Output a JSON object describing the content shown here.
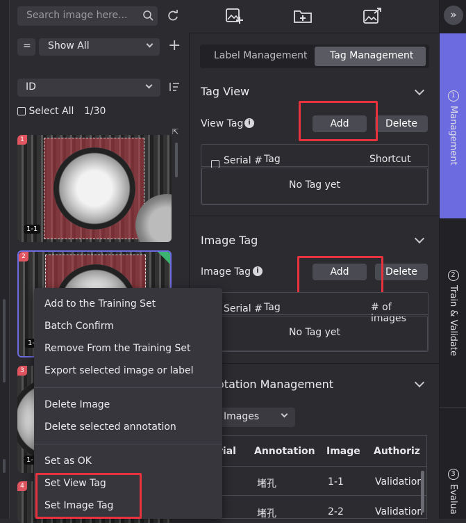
{
  "left": {
    "search_placeholder": "Search image here...",
    "filter_operator": "=",
    "filter_value": "Show All",
    "sort_field": "ID",
    "select_all_label": "Select All",
    "selection_count": "1/30",
    "thumbnails": [
      {
        "index": "1",
        "label": "1-1"
      },
      {
        "index": "2",
        "label": "1-"
      },
      {
        "index": "3",
        "label": "1-"
      },
      {
        "index": "4",
        "label": ""
      }
    ]
  },
  "context_menu": {
    "items": [
      "Add to the Training Set",
      "Batch Confirm",
      "Remove From the Training Set",
      "Export selected image or label",
      "Delete Image",
      "Delete selected annotation",
      "Set as OK",
      "Set View Tag",
      "Set Image Tag"
    ]
  },
  "toolbar": {
    "icons": [
      "add-image-icon",
      "add-folder-icon",
      "export-image-icon"
    ]
  },
  "management": {
    "tabs": [
      "Label Management",
      "Tag Management"
    ],
    "active_tab": "Tag Management",
    "tag_view": {
      "title": "Tag View",
      "row_label": "View Tag",
      "add_label": "Add",
      "delete_label": "Delete",
      "columns": [
        "Serial #",
        "Tag",
        "Shortcut"
      ],
      "empty_text": "No Tag yet"
    },
    "image_tag": {
      "title": "Image Tag",
      "row_label": "Image Tag",
      "add_label": "Add",
      "delete_label": "Delete",
      "columns": [
        "Serial #",
        "Tag",
        "# of images"
      ],
      "empty_text": "No Tag yet"
    },
    "annotation": {
      "title": "otation Management",
      "filter_value": "Images",
      "columns": [
        "rial",
        "Annotation",
        "Image",
        "Authoriz"
      ],
      "rows": [
        {
          "annotation": "堵孔",
          "image": "1-1",
          "auth": "Validation"
        },
        {
          "annotation": "堵孔",
          "image": "2-2",
          "auth": "Validation"
        }
      ]
    }
  },
  "side_tabs": [
    {
      "num": "1",
      "label": "Management"
    },
    {
      "num": "2",
      "label": "Train & Validate"
    },
    {
      "num": "3",
      "label": "Evalua"
    }
  ],
  "colors": {
    "background": "#2b2b30",
    "accent_active_tab": "#6d6be0",
    "highlight_box": "#e8333e",
    "thumb_badge": "#e05560"
  }
}
